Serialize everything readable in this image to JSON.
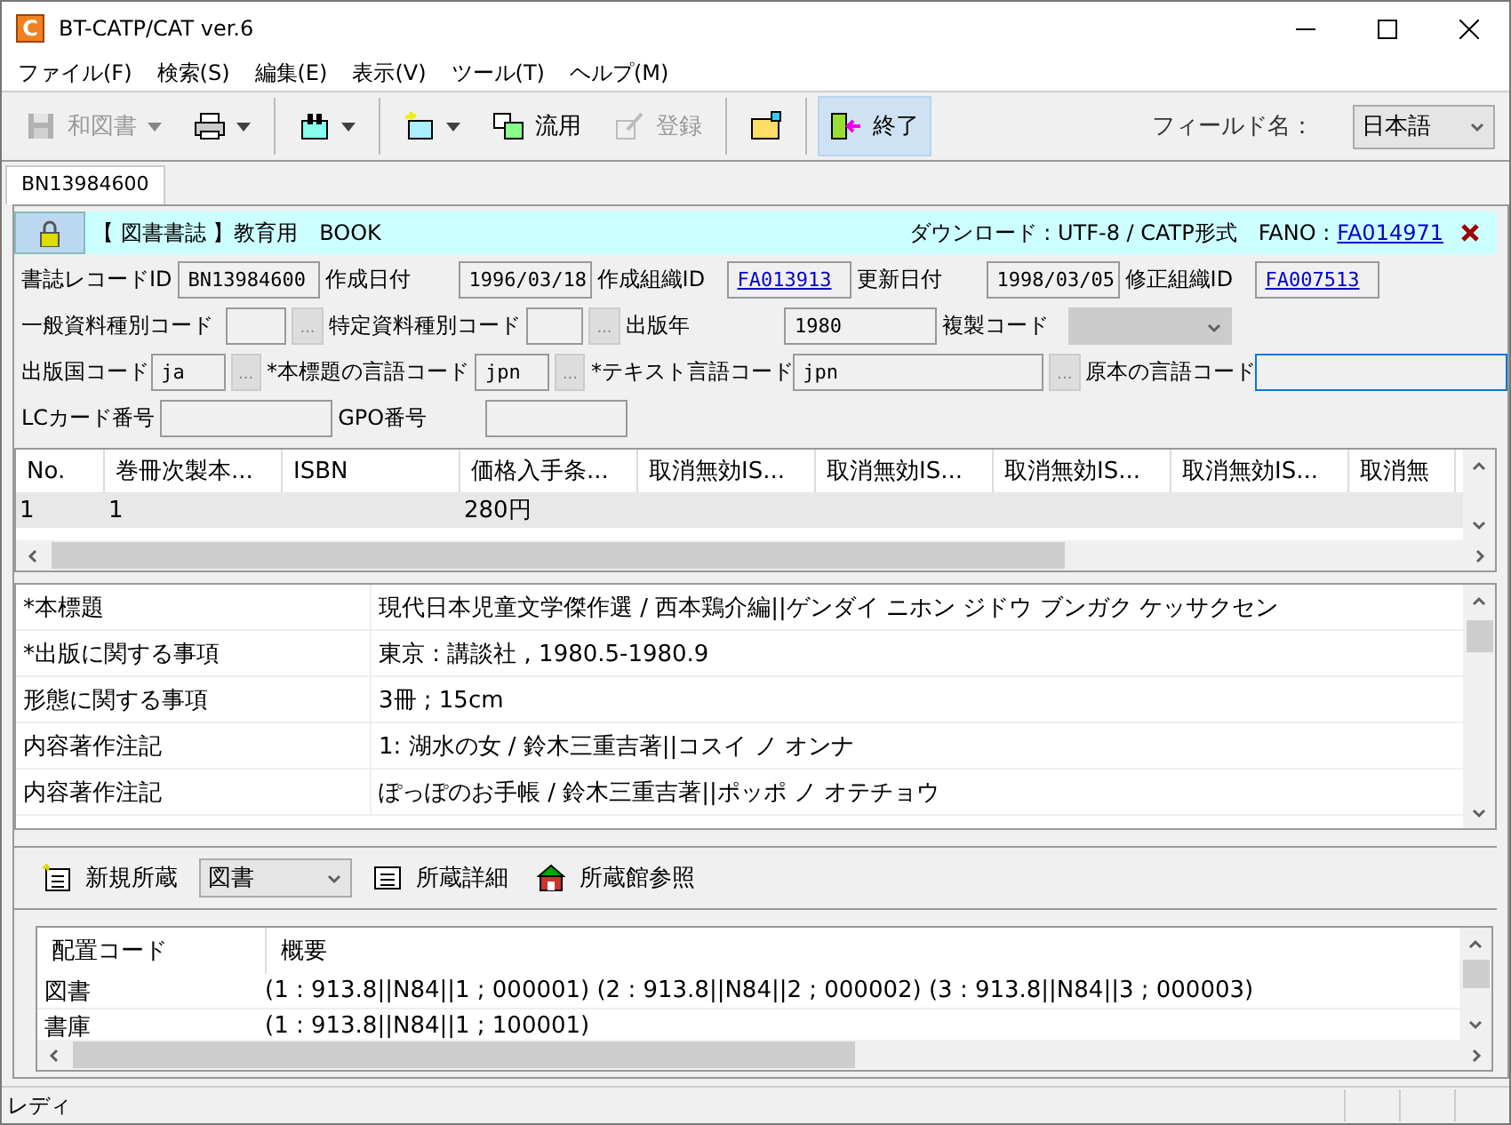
{
  "window": {
    "app_icon": "C",
    "title": "BT-CATP/CAT ver.6"
  },
  "menu": [
    "ファイル(F)",
    "検索(S)",
    "編集(E)",
    "表示(V)",
    "ツール(T)",
    "ヘルプ(M)"
  ],
  "toolbar": {
    "items": [
      {
        "kind": "button",
        "label": "和図書",
        "disabled": true,
        "dropdown": true,
        "highlighted": false
      },
      {
        "kind": "button",
        "disabled": false,
        "dropdown": true,
        "highlighted": false
      },
      {
        "kind": "separator"
      },
      {
        "kind": "button",
        "disabled": false,
        "dropdown": true,
        "highlighted": false
      },
      {
        "kind": "separator"
      },
      {
        "kind": "button",
        "disabled": false,
        "dropdown": true,
        "highlighted": false
      },
      {
        "kind": "button",
        "label": "流用",
        "disabled": false,
        "dropdown": false,
        "highlighted": false
      },
      {
        "kind": "button",
        "label": "登録",
        "disabled": true,
        "dropdown": false,
        "highlighted": false
      },
      {
        "kind": "separator"
      },
      {
        "kind": "button",
        "disabled": false,
        "dropdown": false,
        "highlighted": false
      },
      {
        "kind": "separator"
      },
      {
        "kind": "button",
        "label": "終了",
        "disabled": false,
        "dropdown": false,
        "highlighted": true
      }
    ],
    "field_name_label": "フィールド名：",
    "field_name_value": "日本語"
  },
  "tabs": [
    {
      "label": "BN13984600",
      "selected": true
    }
  ],
  "banner": {
    "title": "【 図書書誌 】教育用　BOOK",
    "download": "ダウンロード : UTF-8 / CATP形式　FANO :",
    "fano": "FA014971"
  },
  "form_rows": [
    [
      {
        "kind": "label",
        "text": "書誌レコードID"
      },
      {
        "kind": "field",
        "value": "BN13984600",
        "focused": false
      },
      {
        "kind": "label",
        "text": "作成日付"
      },
      {
        "kind": "field",
        "value": "1996/03/18",
        "focused": false
      },
      {
        "kind": "label",
        "text": "作成組織ID"
      },
      {
        "kind": "link",
        "value": "FA013913"
      },
      {
        "kind": "label",
        "text": "更新日付"
      },
      {
        "kind": "field",
        "value": "1998/03/05",
        "focused": false
      },
      {
        "kind": "label",
        "text": "修正組織ID"
      },
      {
        "kind": "link",
        "value": "FA007513"
      }
    ],
    [
      {
        "kind": "label",
        "text": "一般資料種別コード"
      },
      {
        "kind": "field",
        "focused": false
      },
      {
        "kind": "picker",
        "text": "..."
      },
      {
        "kind": "label",
        "text": "特定資料種別コード"
      },
      {
        "kind": "field",
        "focused": false
      },
      {
        "kind": "picker",
        "text": "..."
      },
      {
        "kind": "label",
        "text": "出版年"
      },
      {
        "kind": "field",
        "value": "1980",
        "focused": false
      },
      {
        "kind": "label",
        "text": "複製コード"
      },
      {
        "kind": "combo",
        "disabled": true
      }
    ],
    [
      {
        "kind": "label",
        "text": "出版国コード"
      },
      {
        "kind": "field",
        "value": "ja",
        "focused": false
      },
      {
        "kind": "picker",
        "text": "..."
      },
      {
        "kind": "label",
        "text": "*本標題の言語コード"
      },
      {
        "kind": "field",
        "value": "jpn",
        "focused": false
      },
      {
        "kind": "picker",
        "text": "..."
      },
      {
        "kind": "label",
        "text": "*テキスト言語コード"
      },
      {
        "kind": "field",
        "value": "jpn",
        "focused": false
      },
      {
        "kind": "picker",
        "text": "..."
      },
      {
        "kind": "label",
        "text": "原本の言語コード"
      },
      {
        "kind": "field",
        "focused": true
      }
    ],
    [
      {
        "kind": "label",
        "text": "LCカード番号"
      },
      {
        "kind": "field",
        "focused": false
      },
      {
        "kind": "label",
        "text": "GPO番号"
      },
      {
        "kind": "field",
        "focused": false
      }
    ]
  ],
  "items_table": {
    "columns": [
      "No.",
      "巻冊次製本...",
      "ISBN",
      "価格入手条...",
      "取消無効IS...",
      "取消無効IS...",
      "取消無効IS...",
      "取消無効IS...",
      "取消無"
    ],
    "rows": [
      {
        "cells": [
          "1",
          "1",
          null,
          "280円"
        ],
        "selected": true
      }
    ]
  },
  "fields": [
    {
      "label": "*本標題",
      "value": "現代日本児童文学傑作選 / 西本鶏介編||ゲンダイ ニホン ジドウ ブンガク ケッサクセン"
    },
    {
      "label": "*出版に関する事項",
      "value": "東京 : 講談社 , 1980.5-1980.9"
    },
    {
      "label": "形態に関する事項",
      "value": "3冊 ; 15cm"
    },
    {
      "label": "内容著作注記",
      "value": "1: 湖水の女 / 鈴木三重吉著||コスイ ノ オンナ"
    },
    {
      "label": "内容著作注記",
      "value": "ぽっぽのお手帳 / 鈴木三重吉著||ポッポ ノ オテチョウ"
    }
  ],
  "holdings_toolbar": {
    "new_label": "新規所蔵",
    "type_value": "図書",
    "detail_label": "所蔵詳細",
    "libraries_label": "所蔵館参照"
  },
  "holdings": {
    "columns": [
      "配置コード",
      "概要"
    ],
    "rows": [
      {
        "code": "図書",
        "summary": "(1 : 913.8||N84||1 ; 000001) (2 : 913.8||N84||2 ; 000002) (3 : 913.8||N84||3 ; 000003)"
      },
      {
        "code": "書庫",
        "summary": "(1 : 913.8||N84||1 ; 100001)"
      }
    ]
  },
  "status_bar": {
    "text": "レディ"
  }
}
